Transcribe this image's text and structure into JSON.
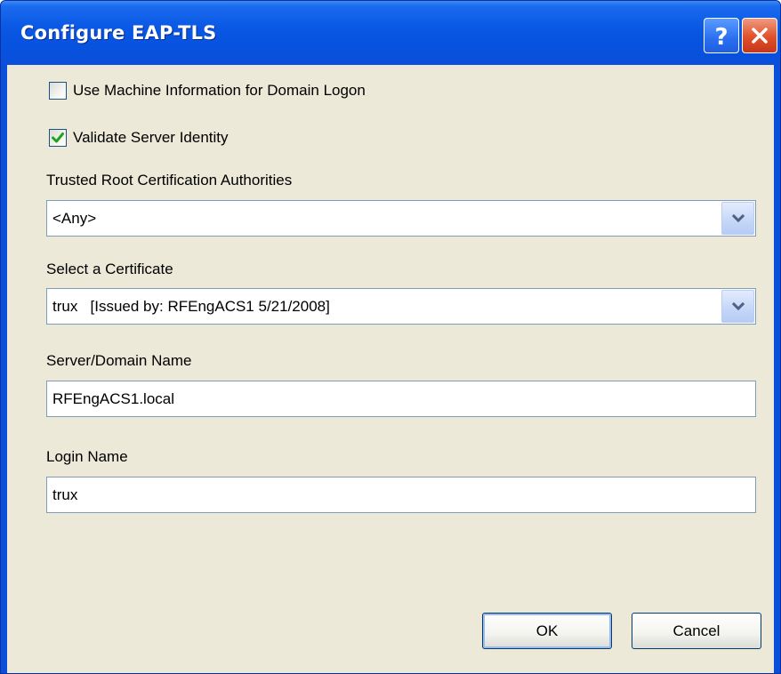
{
  "window": {
    "title": "Configure EAP-TLS",
    "help_icon": "help-icon",
    "close_icon": "close-icon",
    "accent_color": "#0a58e4",
    "close_color": "#e0502a"
  },
  "options": {
    "use_machine_info": {
      "label": "Use Machine Information for Domain Logon",
      "checked": false
    },
    "validate_server": {
      "label": "Validate Server Identity",
      "checked": true
    }
  },
  "trusted_root": {
    "label": "Trusted Root Certification Authorities",
    "value": "<Any>"
  },
  "certificate": {
    "label": "Select a Certificate",
    "value": "trux   [Issued by: RFEngACS1 5/21/2008]"
  },
  "server_domain": {
    "label": "Server/Domain Name",
    "value": "RFEngACS1.local"
  },
  "login": {
    "label": "Login Name",
    "value": "trux"
  },
  "buttons": {
    "ok": "OK",
    "cancel": "Cancel"
  }
}
